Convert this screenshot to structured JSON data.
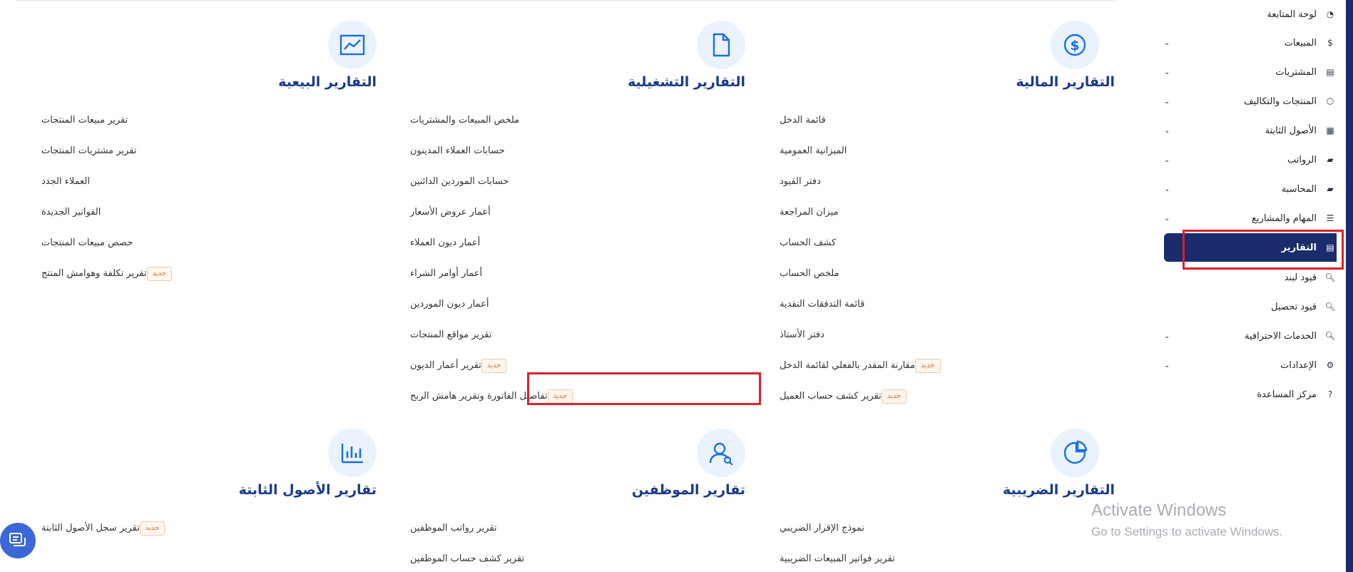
{
  "sections": {
    "financial": {
      "title": "التقارير المالية",
      "icon": "dollar-circle-icon",
      "links": [
        {
          "label": "قائمة الدخل"
        },
        {
          "label": "الميزانية العمومية"
        },
        {
          "label": "دفتر القيود"
        },
        {
          "label": "ميزان المراجعة"
        },
        {
          "label": "كشف الحساب"
        },
        {
          "label": "ملخص الحساب"
        },
        {
          "label": "قائمة التدفقات النقدية"
        },
        {
          "label": "دفتر الأستاذ"
        },
        {
          "label": "مقارنة المقدر بالفعلي لقائمة الدخل",
          "badge": "جديد"
        },
        {
          "label": "تقرير كشف حساب العميل",
          "badge": "جديد"
        }
      ]
    },
    "operational": {
      "title": "التقارير التشغيلية",
      "icon": "document-icon",
      "links": [
        {
          "label": "ملخص المبيعات والمشتريات"
        },
        {
          "label": "حسابات العملاء المدينون"
        },
        {
          "label": "حسابات الموردين الدائنين"
        },
        {
          "label": "أعمار عروض الأسعار"
        },
        {
          "label": "أعمار ديون العملاء"
        },
        {
          "label": "أعمار أوامر الشراء"
        },
        {
          "label": "أعمار ديون الموردين"
        },
        {
          "label": "تقرير مواقع المنتجات"
        },
        {
          "label": "تقرير أعمار الديون",
          "badge": "جديد"
        },
        {
          "label": "تفاصيل الفاتورة وتقرير هامش الربح",
          "badge": "جديد"
        }
      ]
    },
    "sales": {
      "title": "التقارير البيعية",
      "icon": "trend-chart-icon",
      "links": [
        {
          "label": "تقرير مبيعات المنتجات"
        },
        {
          "label": "تقرير مشتريات المنتجات"
        },
        {
          "label": "العملاء الجدد"
        },
        {
          "label": "الفواتير الجديدة"
        },
        {
          "label": "حصص مبيعات المنتجات"
        },
        {
          "label": "تقرير تكلفة وهوامش المنتج",
          "badge": "جديد"
        }
      ]
    },
    "tax": {
      "title": "التقارير الضريبية",
      "icon": "pie-chart-icon",
      "links": [
        {
          "label": "نموذج الإقرار الضريبي"
        },
        {
          "label": "تقرير فواتير المبيعات الضريبية"
        }
      ]
    },
    "employees": {
      "title": "تقارير الموظفين",
      "icon": "users-icon",
      "links": [
        {
          "label": "تقرير رواتب الموظفين"
        },
        {
          "label": "تقرير كشف حساب الموظفين"
        }
      ]
    },
    "assets": {
      "title": "تقارير الأصول الثابتة",
      "icon": "bar-chart-icon",
      "links": [
        {
          "label": "تقرير سجل الأصول الثابتة",
          "badge": "جديد"
        }
      ]
    }
  },
  "sidebar": {
    "items": [
      {
        "label": "لوحة المتابعة",
        "icon": "dashboard-icon",
        "chevron": false
      },
      {
        "label": "المبيعات",
        "icon": "dollar-icon",
        "chevron": true
      },
      {
        "label": "المشتريات",
        "icon": "clipboard-icon",
        "chevron": true
      },
      {
        "label": "المنتجات والتكاليف",
        "icon": "box-icon",
        "chevron": true
      },
      {
        "label": "الأصول الثابتة",
        "icon": "grid-icon",
        "chevron": true
      },
      {
        "label": "الرواتب",
        "icon": "folder-icon",
        "chevron": true
      },
      {
        "label": "المحاسبة",
        "icon": "folder-icon",
        "chevron": true
      },
      {
        "label": "المهام والمشاريع",
        "icon": "tasks-icon",
        "chevron": true
      },
      {
        "label": "التقارير",
        "icon": "report-icon",
        "chevron": false,
        "active": true
      },
      {
        "label": "قيود لبند",
        "icon": "search-icon",
        "chevron": false
      },
      {
        "label": "قيود تحصيل",
        "icon": "search-icon",
        "chevron": false
      },
      {
        "label": "الخدمات الاحترافية",
        "icon": "search-icon",
        "chevron": true
      },
      {
        "label": "الإعدادات",
        "icon": "gear-icon",
        "chevron": true
      },
      {
        "label": "مركز المساعدة",
        "icon": "help-icon",
        "chevron": false
      }
    ]
  },
  "watermark": {
    "line1": "Activate Windows",
    "line2": "Go to Settings to activate Windows."
  },
  "colors": {
    "title": "#1c3a8a",
    "icon": "#1b6fe0",
    "icon_bg": "#eaf3fd",
    "sidebar_active": "#1a2c6b",
    "badge": "#e06b2e",
    "highlight": "#d8232a"
  }
}
